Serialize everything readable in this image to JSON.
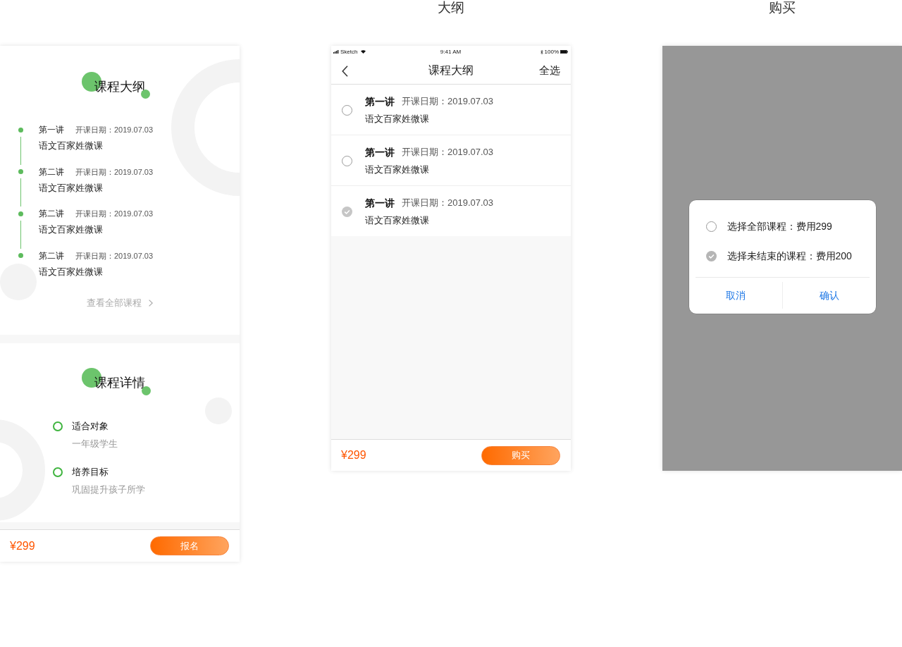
{
  "detail_screen": {
    "outline": {
      "title": "课程大纲",
      "lessons": [
        {
          "name": "第一讲",
          "date": "开课日期：2019.07.03",
          "course": "语文百家姓微课"
        },
        {
          "name": "第二讲",
          "date": "开课日期：2019.07.03",
          "course": "语文百家姓微课"
        },
        {
          "name": "第二讲",
          "date": "开课日期：2019.07.03",
          "course": "语文百家姓微课"
        },
        {
          "name": "第二讲",
          "date": "开课日期：2019.07.03",
          "course": "语文百家姓微课"
        }
      ],
      "view_all": "查看全部课程"
    },
    "details": {
      "title": "课程详情",
      "items": [
        {
          "label": "适合对象",
          "value": "一年级学生"
        },
        {
          "label": "培养目标",
          "value": "巩固提升孩子所学"
        }
      ]
    },
    "footer": {
      "price": "¥299",
      "button": "报名"
    }
  },
  "outline_screen": {
    "caption": "大纲",
    "status_bar": {
      "carrier": "Sketch",
      "time": "9:41 AM",
      "battery": "100%"
    },
    "nav": {
      "title": "课程大纲",
      "action": "全选"
    },
    "lessons": [
      {
        "name": "第一讲",
        "date": "开课日期：2019.07.03",
        "course": "语文百家姓微课",
        "checked": false
      },
      {
        "name": "第一讲",
        "date": "开课日期：2019.07.03",
        "course": "语文百家姓微课",
        "checked": false
      },
      {
        "name": "第一讲",
        "date": "开课日期：2019.07.03",
        "course": "语文百家姓微课",
        "checked": true
      }
    ],
    "footer": {
      "price": "¥299",
      "button": "购买"
    }
  },
  "purchase_screen": {
    "caption": "购买",
    "dialog": {
      "options": [
        {
          "label": "选择全部课程：费用299",
          "selected": false
        },
        {
          "label": "选择未结束的课程：费用200",
          "selected": true
        }
      ],
      "buttons": [
        "取消",
        "确认"
      ]
    }
  }
}
